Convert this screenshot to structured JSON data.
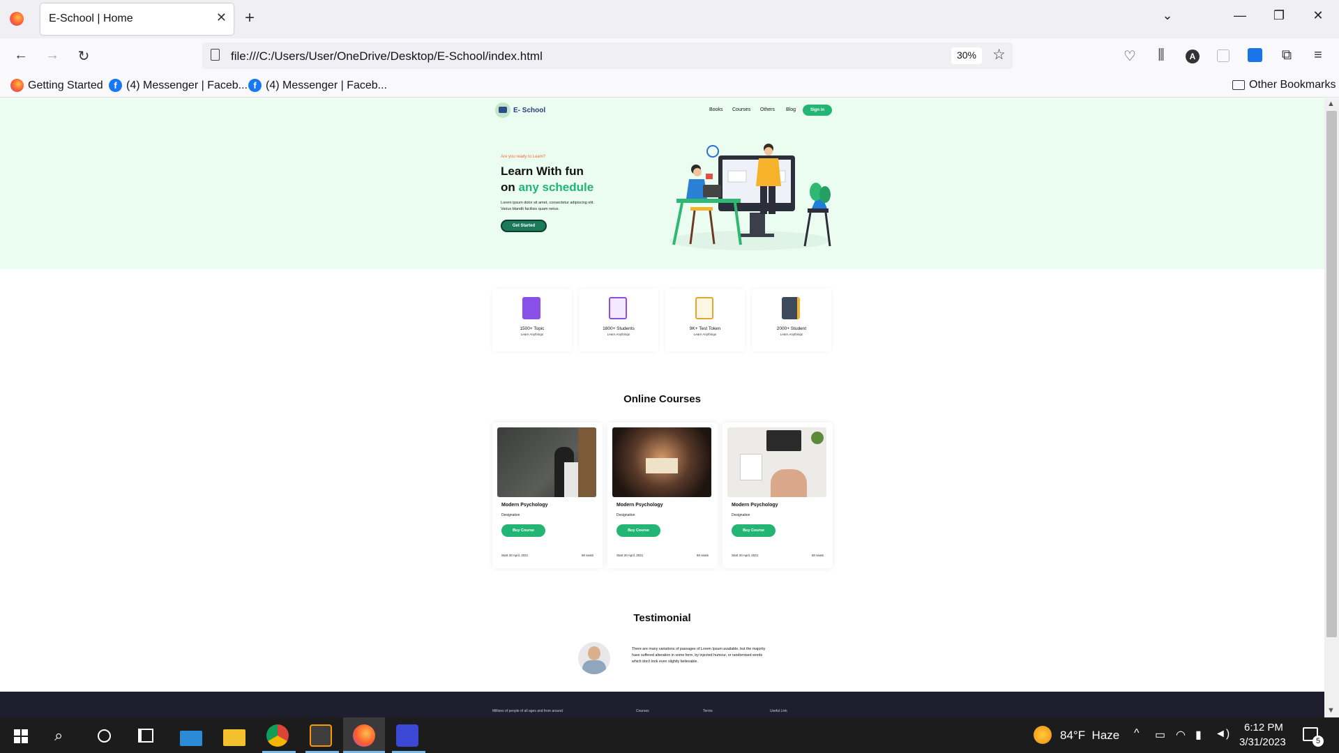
{
  "browser": {
    "tab_title": "E-School | Home",
    "url": "file:///C:/Users/User/OneDrive/Desktop/E-School/index.html",
    "zoom": "30%",
    "bookmarks": [
      "Getting Started",
      "(4) Messenger | Faceb...",
      "(4) Messenger | Faceb..."
    ],
    "other_bookmarks": "Other Bookmarks"
  },
  "site": {
    "logo": "E- School",
    "nav": [
      "Books",
      "Courses",
      "Others",
      "Blog"
    ],
    "signin": "Sign in",
    "hero": {
      "kicker": "Are you ready to Learn?",
      "title_line1": "Learn With fun",
      "title_on": "on ",
      "title_accent": "any schedule",
      "body": "Lorem ipsum dolor sit amet, consectetur adipiscing elit. Varius blandit facilisis quam netus.",
      "cta": "Get Started"
    },
    "stats": [
      {
        "title": "1500+ Topic",
        "sub": "Learn Anythings",
        "icon": "book-icon"
      },
      {
        "title": "1800+ Students",
        "sub": "Learn Anythings",
        "icon": "certificate-icon"
      },
      {
        "title": "9K+ Test Token",
        "sub": "Learn Anythings",
        "icon": "clipboard-icon"
      },
      {
        "title": "2000+ Student",
        "sub": "Learn Anythings",
        "icon": "notebook-icon"
      }
    ],
    "courses_title": "Online Courses",
    "courses": [
      {
        "title": "Modern Psychology",
        "designation": "Designation",
        "button": "Buy Course",
        "date": "Start 20 April, 2021",
        "seats": "60 seats"
      },
      {
        "title": "Modern Psychology",
        "designation": "Designation",
        "button": "Buy Course",
        "date": "Start 20 April, 2021",
        "seats": "60 seats"
      },
      {
        "title": "Modern Psychology",
        "designation": "Designation",
        "button": "Buy Course",
        "date": "Start 20 April, 2021",
        "seats": "60 seats"
      }
    ],
    "testimonial_title": "Testimonial",
    "testimonial_text": "There are many variations of passages of Lorem Ipsum available, but the majority have suffered alteration in some form, by injected humour, or randomised words which don't look even slightly believable.",
    "footer": [
      "Millions of people of all ages and from around",
      "Courses",
      "Terms",
      "Useful Link"
    ]
  },
  "taskbar": {
    "weather": "84°F  Haze",
    "time": "6:12 PM",
    "date": "3/31/2023",
    "notifications": "5"
  },
  "colors": {
    "accent": "#22b573",
    "hero_bg": "#eafdf0",
    "kicker": "#ff6b2c"
  }
}
